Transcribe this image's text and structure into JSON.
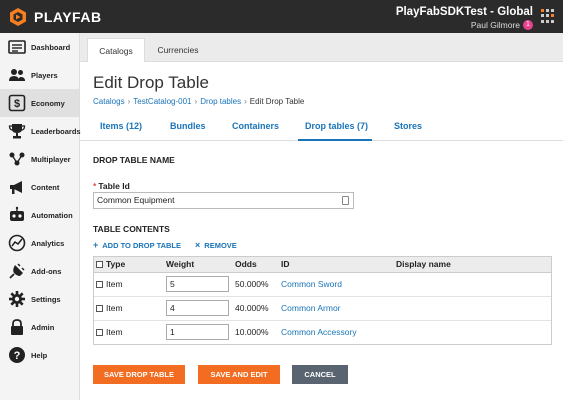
{
  "header": {
    "brand": "PLAYFAB",
    "title": "PlayFabSDKTest - Global",
    "user": "Paul Gilmore",
    "notification_count": "1"
  },
  "sidebar": {
    "items": [
      {
        "label": "Dashboard",
        "icon": "dashboard-icon"
      },
      {
        "label": "Players",
        "icon": "players-icon"
      },
      {
        "label": "Economy",
        "icon": "economy-icon",
        "active": true
      },
      {
        "label": "Leaderboards",
        "icon": "trophy-icon"
      },
      {
        "label": "Multiplayer",
        "icon": "multiplayer-icon"
      },
      {
        "label": "Content",
        "icon": "megaphone-icon"
      },
      {
        "label": "Automation",
        "icon": "robot-icon"
      },
      {
        "label": "Analytics",
        "icon": "analytics-icon"
      },
      {
        "label": "Add-ons",
        "icon": "plug-icon"
      },
      {
        "label": "Settings",
        "icon": "gear-icon"
      },
      {
        "label": "Admin",
        "icon": "lock-icon"
      },
      {
        "label": "Help",
        "icon": "help-icon"
      }
    ]
  },
  "tabs": [
    "Catalogs",
    "Currencies"
  ],
  "page": {
    "title": "Edit Drop Table",
    "breadcrumb": [
      "Catalogs",
      "TestCatalog-001",
      "Drop tables",
      "Edit Drop Table"
    ]
  },
  "subtabs": [
    "Items (12)",
    "Bundles",
    "Containers",
    "Drop tables (7)",
    "Stores"
  ],
  "form": {
    "section_name": "DROP TABLE NAME",
    "table_id_label": "Table Id",
    "table_id_value": "Common Equipment",
    "section_contents": "TABLE CONTENTS",
    "add_link": "ADD TO DROP TABLE",
    "remove_link": "REMOVE"
  },
  "table": {
    "headers": [
      "Type",
      "Weight",
      "Odds",
      "ID",
      "Display name"
    ],
    "rows": [
      {
        "type": "Item",
        "weight": "5",
        "odds": "50.000%",
        "id": "Common Sword",
        "display_name": ""
      },
      {
        "type": "Item",
        "weight": "4",
        "odds": "40.000%",
        "id": "Common Armor",
        "display_name": ""
      },
      {
        "type": "Item",
        "weight": "1",
        "odds": "10.000%",
        "id": "Common Accessory",
        "display_name": ""
      }
    ]
  },
  "buttons": {
    "save": "SAVE DROP TABLE",
    "save_edit": "SAVE AND EDIT",
    "cancel": "CANCEL"
  },
  "colors": {
    "accent_orange": "#f26c22",
    "link_blue": "#1a74ba",
    "cancel_gray": "#5a6470",
    "topbar": "#2b2b2b"
  }
}
